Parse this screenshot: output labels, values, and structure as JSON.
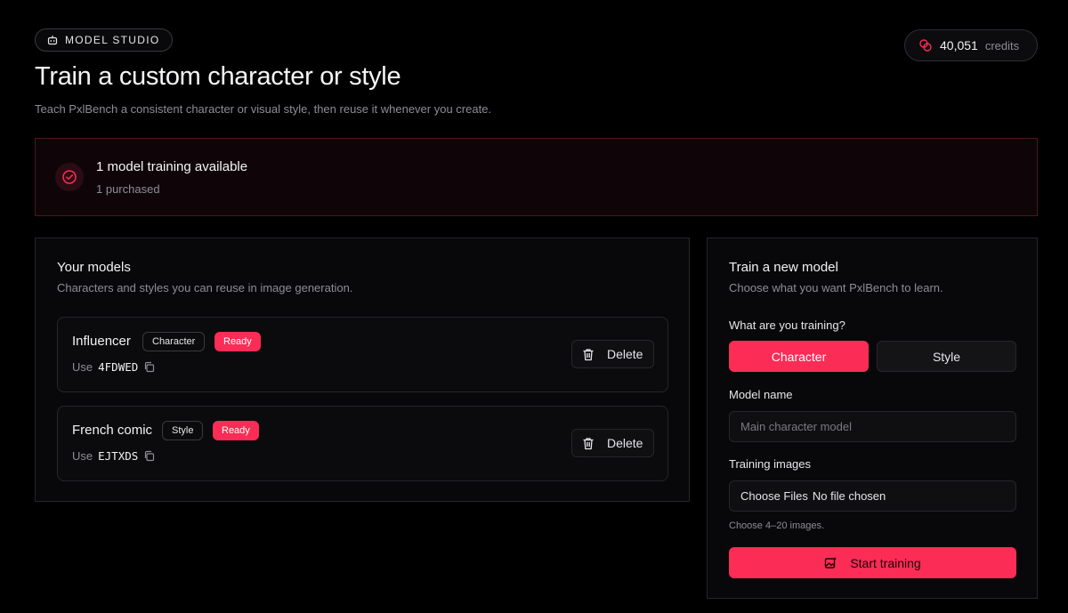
{
  "header": {
    "tag": "MODEL STUDIO",
    "title": "Train a custom character or style",
    "subtitle": "Teach PxlBench a consistent character or visual style, then reuse it whenever you create."
  },
  "credits": {
    "value": "40,051",
    "label": "credits"
  },
  "banner": {
    "title": "1 model training available",
    "detail": "1 purchased"
  },
  "models_panel": {
    "title": "Your models",
    "subtitle": "Characters and styles you can reuse in image generation.",
    "items": [
      {
        "name": "Influencer",
        "type": "Character",
        "status": "Ready",
        "use_label": "Use",
        "code": "4FDWED",
        "delete_label": "Delete"
      },
      {
        "name": "French comic",
        "type": "Style",
        "status": "Ready",
        "use_label": "Use",
        "code": "EJTXDS",
        "delete_label": "Delete"
      }
    ]
  },
  "train_panel": {
    "title": "Train a new model",
    "subtitle": "Choose what you want PxlBench to learn.",
    "question": "What are you training?",
    "options": [
      "Character",
      "Style"
    ],
    "selected": "Character",
    "name_label": "Model name",
    "name_placeholder": "Main character model",
    "images_label": "Training images",
    "file_button": "Choose Files",
    "file_status": "No file chosen",
    "hint": "Choose 4–20 images.",
    "submit": "Start training"
  },
  "colors": {
    "accent": "#fb2c55",
    "background": "#000000",
    "panel": "#08080a",
    "border": "#26262b"
  },
  "icons": [
    "robot-icon",
    "coins-icon",
    "check-circle-icon",
    "copy-icon",
    "trash-icon",
    "image-sparkle-icon"
  ]
}
